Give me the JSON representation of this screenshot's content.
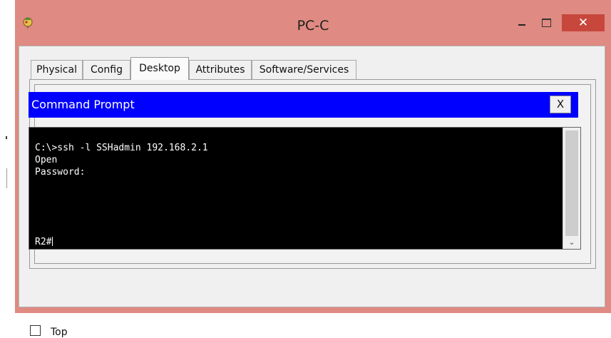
{
  "window": {
    "title": "PC-C",
    "minimize_icon": "minimize-icon",
    "maximize_icon": "maximize-icon",
    "close_label": "✕",
    "app_icon": "packet-tracer-pc-icon"
  },
  "tabs": [
    {
      "label": "Physical",
      "active": false
    },
    {
      "label": "Config",
      "active": false
    },
    {
      "label": "Desktop",
      "active": true
    },
    {
      "label": "Attributes",
      "active": false
    },
    {
      "label": "Software/Services",
      "active": false
    }
  ],
  "command_prompt": {
    "title": "Command Prompt",
    "close_label": "X",
    "lines": [
      "C:\\>ssh -l SSHadmin 192.168.2.1",
      "Open",
      "Password:"
    ],
    "prompt": "R2#"
  },
  "footer": {
    "top_checkbox_label": "Top",
    "top_checked": false
  },
  "colors": {
    "window_frame": "#df8a82",
    "close_button": "#c7473c",
    "cmd_header": "#0000ff",
    "terminal_bg": "#000000",
    "terminal_fg": "#ffffff"
  }
}
